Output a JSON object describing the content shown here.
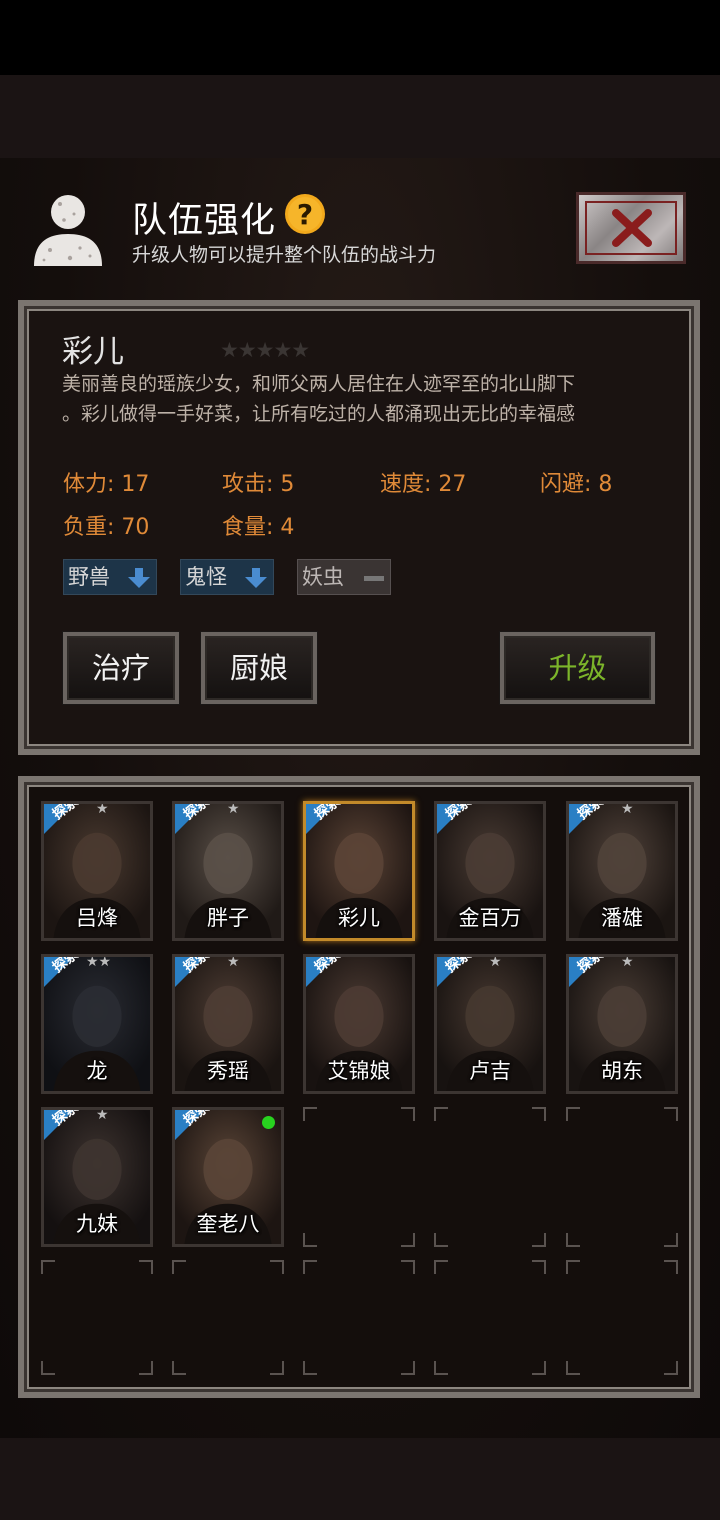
{
  "header": {
    "title": "队伍强化",
    "subtitle": "升级人物可以提升整个队伍的战斗力",
    "help_icon": "question-mark-icon",
    "close_icon": "close-x-icon"
  },
  "character": {
    "name": "彩儿",
    "star_rating": "0 of 5",
    "stars_text": "★★★★★",
    "description_line1": "美丽善良的瑶族少女，和师父两人居住在人迹罕至的北山脚下",
    "description_line2": "。彩儿做得一手好菜，让所有吃过的人都涌现出无比的幸福感",
    "stats": {
      "stamina": "体力: 17",
      "attack": "攻击: 5",
      "speed": "速度: 27",
      "dodge": "闪避: 8",
      "load": "负重: 70",
      "food": "食量: 4"
    },
    "tags": {
      "beast": "野兽",
      "ghost": "鬼怪",
      "bug": "妖虫"
    },
    "buttons": {
      "heal": "治疗",
      "cook": "厨娘",
      "upgrade": "升级"
    }
  },
  "ribbon_label": "探索",
  "roster": [
    {
      "name": "吕烽",
      "stars": "★",
      "selected": false
    },
    {
      "name": "胖子",
      "stars": "★",
      "selected": false
    },
    {
      "name": "彩儿",
      "stars": "",
      "selected": true
    },
    {
      "name": "金百万",
      "stars": "",
      "selected": false
    },
    {
      "name": "潘雄",
      "stars": "★",
      "selected": false
    },
    {
      "name": "龙",
      "stars": "★★",
      "selected": false
    },
    {
      "name": "秀瑶",
      "stars": "★",
      "selected": false
    },
    {
      "name": "艾锦娘",
      "stars": "",
      "selected": false
    },
    {
      "name": "卢吉",
      "stars": "★",
      "selected": false
    },
    {
      "name": "胡东",
      "stars": "★",
      "selected": false
    },
    {
      "name": "九妹",
      "stars": "★",
      "selected": false
    },
    {
      "name": "奎老八",
      "stars": "",
      "selected": false,
      "online": true
    }
  ],
  "colors": {
    "stat_orange": "#e08a38",
    "upgrade_green": "#7cb52a",
    "tag_blue": "#1d3448",
    "selected_border": "#c28a2a",
    "online_green": "#28d21f"
  }
}
